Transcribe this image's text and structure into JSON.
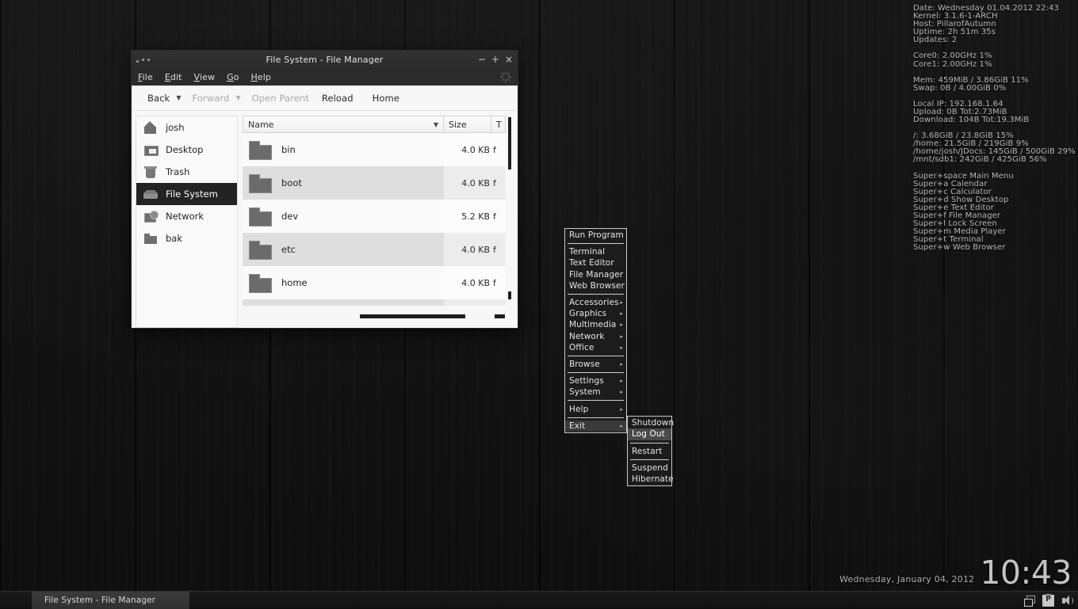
{
  "conky": {
    "system": [
      "Date: Wednesday 01.04.2012 22:43",
      "Kernel: 3.1.6-1-ARCH",
      "Host: PillarofAutumn",
      "Uptime: 2h 51m 35s",
      "Updates: 2"
    ],
    "cpu": [
      "Core0: 2.00GHz 1%",
      "Core1: 2.00GHz 1%"
    ],
    "memory": [
      "Mem: 459MiB / 3.86GiB 11%",
      "Swap: 0B  / 4.00GiB 0%"
    ],
    "network": [
      "Local IP: 192.168.1.64",
      "Upload: 0B  Tot:2.73MiB",
      "Download: 104B  Tot:19.3MiB"
    ],
    "disks": [
      "/: 3.68GiB / 23.8GiB 15%",
      "/home: 21.5GiB / 219GiB 9%",
      "/home/josh/JDocs: 145GiB / 500GiB 29%",
      "/mnt/sdb1: 242GiB / 425GiB 56%"
    ],
    "shortcuts": [
      "Super+space Main Menu",
      "Super+a Calendar",
      "Super+c Calculator",
      "Super+d Show Desktop",
      "Super+e Text Editor",
      "Super+f File Manager",
      "Super+l Lock Screen",
      "Super+m Media Player",
      "Super+t Terminal",
      "Super+w Web Browser"
    ]
  },
  "filemanager": {
    "title": "File System - File Manager",
    "window_buttons": {
      "minimize": "−",
      "maximize": "+",
      "close": "×"
    },
    "menubar": [
      {
        "label": "File",
        "accel": "F"
      },
      {
        "label": "Edit",
        "accel": "E"
      },
      {
        "label": "View",
        "accel": "V"
      },
      {
        "label": "Go",
        "accel": "G"
      },
      {
        "label": "Help",
        "accel": "H"
      }
    ],
    "toolbar": {
      "back": "Back",
      "forward": "Forward",
      "open_parent": "Open Parent",
      "reload": "Reload",
      "home": "Home"
    },
    "sidebar": [
      {
        "label": "josh",
        "icon": "home-icon",
        "selected": false
      },
      {
        "label": "Desktop",
        "icon": "desktop-icon",
        "selected": false
      },
      {
        "label": "Trash",
        "icon": "trash-icon",
        "selected": false
      },
      {
        "label": "File System",
        "icon": "drive-icon",
        "selected": true
      },
      {
        "label": "Network",
        "icon": "network-icon",
        "selected": false
      },
      {
        "label": "bak",
        "icon": "folder-icon",
        "selected": false
      }
    ],
    "columns": {
      "name": "Name",
      "size": "Size",
      "type": "T"
    },
    "rows": [
      {
        "name": "bin",
        "size": "4.0 KB",
        "type": "f"
      },
      {
        "name": "boot",
        "size": "4.0 KB",
        "type": "f"
      },
      {
        "name": "dev",
        "size": "5.2 KB",
        "type": "f"
      },
      {
        "name": "etc",
        "size": "4.0 KB",
        "type": "f"
      },
      {
        "name": "home",
        "size": "4.0 KB",
        "type": "f"
      }
    ]
  },
  "rootmenu": {
    "items": [
      {
        "label": "Run Program",
        "submenu": false,
        "selected": false
      },
      {
        "sep": true
      },
      {
        "label": "Terminal",
        "submenu": false,
        "selected": false
      },
      {
        "label": "Text Editor",
        "submenu": false,
        "selected": false
      },
      {
        "label": "File Manager",
        "submenu": false,
        "selected": false
      },
      {
        "label": "Web Browser",
        "submenu": false,
        "selected": false
      },
      {
        "sep": true
      },
      {
        "label": "Accessories",
        "submenu": true,
        "selected": false
      },
      {
        "label": "Graphics",
        "submenu": true,
        "selected": false
      },
      {
        "label": "Multimedia",
        "submenu": true,
        "selected": false
      },
      {
        "label": "Network",
        "submenu": true,
        "selected": false
      },
      {
        "label": "Office",
        "submenu": true,
        "selected": false
      },
      {
        "sep": true
      },
      {
        "label": "Browse",
        "submenu": true,
        "selected": false
      },
      {
        "sep": true
      },
      {
        "label": "Settings",
        "submenu": true,
        "selected": false
      },
      {
        "label": "System",
        "submenu": true,
        "selected": false
      },
      {
        "sep": true
      },
      {
        "label": "Help",
        "submenu": true,
        "selected": false
      },
      {
        "sep": true
      },
      {
        "label": "Exit",
        "submenu": true,
        "selected": true
      }
    ]
  },
  "exitmenu": {
    "items": [
      {
        "label": "Shutdown",
        "selected": false
      },
      {
        "label": "Log Out",
        "selected": true
      },
      {
        "sep": true
      },
      {
        "label": "Restart",
        "selected": false
      },
      {
        "sep": true
      },
      {
        "label": "Suspend",
        "selected": false
      },
      {
        "label": "Hibernate",
        "selected": false
      }
    ]
  },
  "clock": {
    "date": "Wednesday, January 04, 2012",
    "time": "10:43"
  },
  "taskbar": {
    "buttons": [
      {
        "label": "File System - File Manager",
        "active": true
      }
    ],
    "tray": [
      {
        "icon": "windows-icon"
      },
      {
        "icon": "clipboard-icon"
      },
      {
        "icon": "volume-icon"
      }
    ]
  }
}
